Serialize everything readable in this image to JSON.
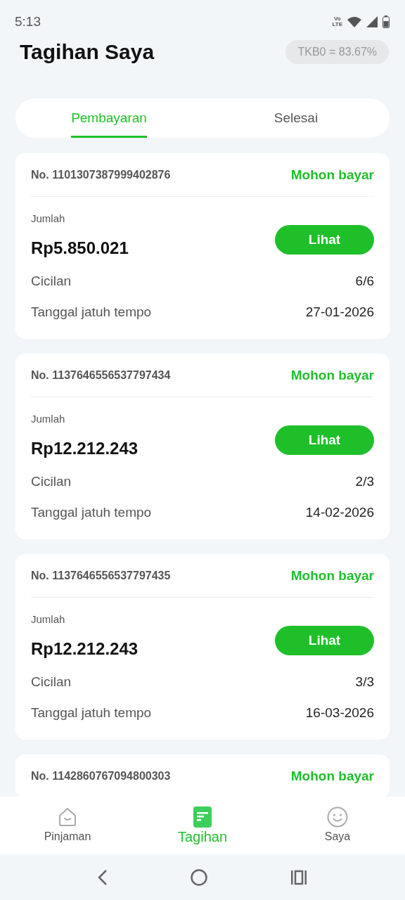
{
  "status_bar": {
    "time": "5:13",
    "network_badge": [
      "Vo",
      "LTE"
    ]
  },
  "header": {
    "title": "Tagihan Saya",
    "rate_badge": "TKB0 = 83.67%"
  },
  "tabs": [
    {
      "label": "Pembayaran",
      "selected": true
    },
    {
      "label": "Selesai",
      "selected": false
    }
  ],
  "bills": [
    {
      "number": "No. 1101307387999402876",
      "status": "Mohon bayar",
      "amount_label": "Jumlah",
      "amount": "Rp5.850.021",
      "button": "Lihat",
      "rows": [
        {
          "label": "Cicilan",
          "value": "6/6"
        },
        {
          "label": "Tanggal jatuh tempo",
          "value": "27-01-2026"
        }
      ]
    },
    {
      "number": "No. 1137646556537797434",
      "status": "Mohon bayar",
      "amount_label": "Jumlah",
      "amount": "Rp12.212.243",
      "button": "Lihat",
      "rows": [
        {
          "label": "Cicilan",
          "value": "2/3"
        },
        {
          "label": "Tanggal jatuh tempo",
          "value": "14-02-2026"
        }
      ]
    },
    {
      "number": "No. 1137646556537797435",
      "status": "Mohon bayar",
      "amount_label": "Jumlah",
      "amount": "Rp12.212.243",
      "button": "Lihat",
      "rows": [
        {
          "label": "Cicilan",
          "value": "3/3"
        },
        {
          "label": "Tanggal jatuh tempo",
          "value": "16-03-2026"
        }
      ]
    },
    {
      "number": "No. 1142860767094800303",
      "status": "Mohon bayar"
    }
  ],
  "bottom_nav": [
    {
      "kind": "home",
      "label": "Pinjaman",
      "selected": false
    },
    {
      "kind": "bill",
      "label": "Tagihan",
      "selected": true
    },
    {
      "kind": "smile",
      "label": "Saya",
      "selected": false
    }
  ]
}
